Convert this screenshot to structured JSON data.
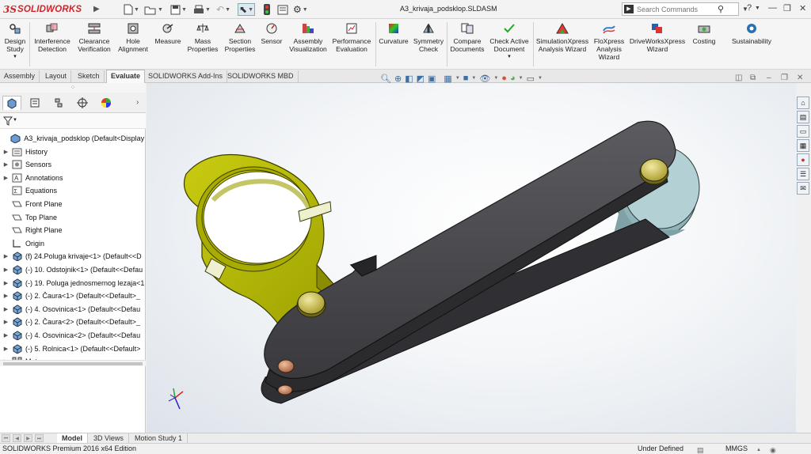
{
  "app": {
    "brand_mark": "3S",
    "brand_name": "SOLIDWORKS",
    "document_title": "A3_krivaja_podsklop.SLDASM",
    "search_placeholder": "Search Commands"
  },
  "commands": [
    {
      "label": "Design Study",
      "icon": "design-study-icon"
    },
    {
      "label": "Interference Detection",
      "icon": "interference-detection-icon"
    },
    {
      "label": "Clearance Verification",
      "icon": "clearance-verification-icon"
    },
    {
      "label": "Hole Alignment",
      "icon": "hole-alignment-icon"
    },
    {
      "label": "Measure",
      "icon": "measure-icon"
    },
    {
      "label": "Mass Properties",
      "icon": "mass-properties-icon"
    },
    {
      "label": "Section Properties",
      "icon": "section-properties-icon"
    },
    {
      "label": "Sensor",
      "icon": "sensor-icon"
    },
    {
      "label": "Assembly Visualization",
      "icon": "assembly-visualization-icon"
    },
    {
      "label": "Performance Evaluation",
      "icon": "performance-evaluation-icon"
    },
    {
      "label": "Curvature",
      "icon": "curvature-icon"
    },
    {
      "label": "Symmetry Check",
      "icon": "symmetry-check-icon"
    },
    {
      "label": "Compare Documents",
      "icon": "compare-documents-icon"
    },
    {
      "label": "Check Active Document",
      "icon": "check-active-document-icon"
    },
    {
      "label": "SimulationXpress Analysis Wizard",
      "icon": "simulationxpress-icon"
    },
    {
      "label": "FloXpress Analysis Wizard",
      "icon": "floxpress-icon"
    },
    {
      "label": "DriveWorksXpress Wizard",
      "icon": "driveworksxpress-icon"
    },
    {
      "label": "Costing",
      "icon": "costing-icon"
    },
    {
      "label": "Sustainability",
      "icon": "sustainability-icon"
    }
  ],
  "tabs": [
    "Assembly",
    "Layout",
    "Sketch",
    "Evaluate",
    "SOLIDWORKS Add-Ins",
    "SOLIDWORKS MBD"
  ],
  "active_tab": "Evaluate",
  "tree": {
    "root": "A3_krivaja_podsklop  (Default<Display Sta",
    "items": [
      {
        "label": "History",
        "icon": "history-icon"
      },
      {
        "label": "Sensors",
        "icon": "sensors-icon"
      },
      {
        "label": "Annotations",
        "icon": "annotations-icon"
      },
      {
        "label": "Equations",
        "icon": "equations-icon"
      },
      {
        "label": "Front Plane",
        "icon": "plane-icon"
      },
      {
        "label": "Top Plane",
        "icon": "plane-icon"
      },
      {
        "label": "Right Plane",
        "icon": "plane-icon"
      },
      {
        "label": "Origin",
        "icon": "origin-icon"
      },
      {
        "label": "(f) 24.Poluga krivaje<1> (Default<<D",
        "icon": "part-icon"
      },
      {
        "label": "(-) 10. Odstojnik<1> (Default<<Defau",
        "icon": "part-icon"
      },
      {
        "label": "(-) 19. Poluga jednosmernog lezaja<1",
        "icon": "part-icon"
      },
      {
        "label": "(-) 2. Čaura<1> (Default<<Default>_",
        "icon": "part-icon"
      },
      {
        "label": "(-) 4. Osovinica<1> (Default<<Defau",
        "icon": "part-icon"
      },
      {
        "label": "(-) 2. Čaura<2> (Default<<Default>_",
        "icon": "part-icon"
      },
      {
        "label": "(-) 4. Osovinica<2> (Default<<Defau",
        "icon": "part-icon"
      },
      {
        "label": "(-) 5. Rolnica<1> (Default<<Default>",
        "icon": "part-icon"
      },
      {
        "label": "Mates",
        "icon": "mates-icon"
      }
    ]
  },
  "bottom_tabs": [
    "Model",
    "3D Views",
    "Motion Study 1"
  ],
  "active_bottom_tab": "Model",
  "status": {
    "edition": "SOLIDWORKS Premium 2016 x64 Edition",
    "state": "Under Defined",
    "units": "MMGS"
  },
  "colors": {
    "brand": "#d2232a",
    "clamp": "#c8cc10",
    "lever": "#4a4a4e",
    "roller": "#a9c9cc",
    "pin": "#cfc34a",
    "bushing": "#c97f5a"
  }
}
